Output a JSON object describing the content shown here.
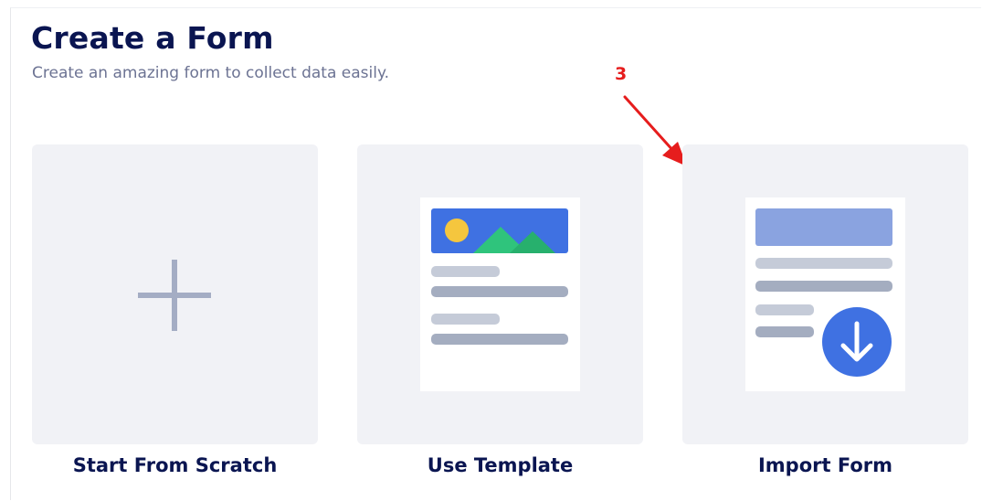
{
  "header": {
    "title": "Create a Form",
    "subtitle": "Create an amazing form to collect data easily."
  },
  "annotation": {
    "step_number": "3",
    "color": "#e61d1d",
    "arrow_icon": "red-arrow-icon"
  },
  "options": [
    {
      "label": "Start From Scratch",
      "icon": "plus-icon"
    },
    {
      "label": "Use Template",
      "icon": "template-document-icon"
    },
    {
      "label": "Import Form",
      "icon": "import-document-icon"
    }
  ],
  "colors": {
    "title": "#0a1551",
    "subtitle": "#6c7393",
    "card_background": "#f1f2f6",
    "accent_blue": "#3f71e2",
    "sun_yellow": "#f5c63e",
    "mountain_green": "#2fc47c"
  }
}
